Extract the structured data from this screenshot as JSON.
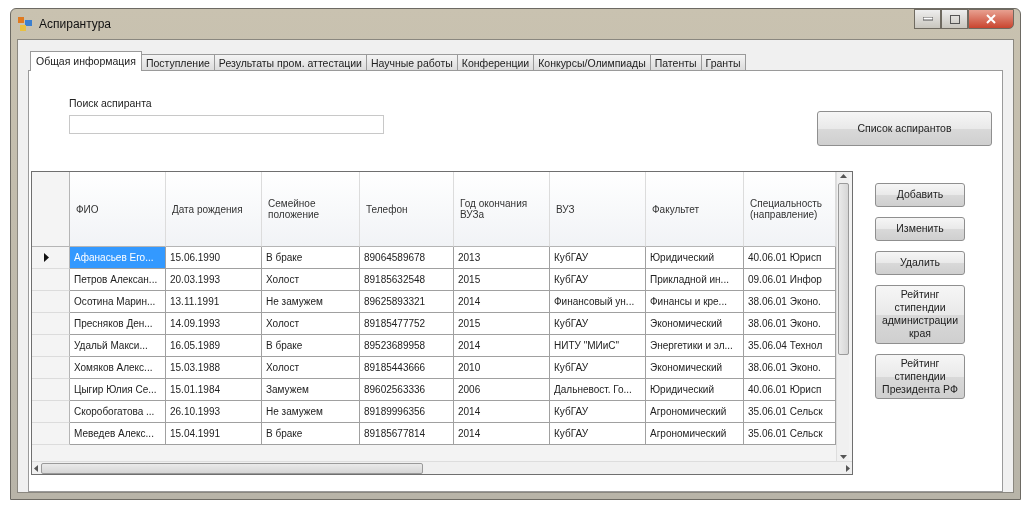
{
  "window": {
    "title": "Аспирантура"
  },
  "tabs": [
    {
      "label": "Общая информация",
      "selected": true
    },
    {
      "label": "Поступление",
      "selected": false
    },
    {
      "label": "Результаты пром. аттестации",
      "selected": false
    },
    {
      "label": "Научные работы",
      "selected": false
    },
    {
      "label": "Конференции",
      "selected": false
    },
    {
      "label": "Конкурсы/Олимпиады",
      "selected": false
    },
    {
      "label": "Патенты",
      "selected": false
    },
    {
      "label": "Гранты",
      "selected": false
    }
  ],
  "search": {
    "label": "Поиск аспиранта"
  },
  "list_button": "Список аспирантов",
  "table": {
    "columns": [
      "ФИО",
      "Дата рождения",
      "Семейное положение",
      "Телефон",
      "Год окончания ВУЗа",
      "ВУЗ",
      "Факультет",
      "Специальность (направление)"
    ],
    "rows": [
      {
        "selected": true,
        "cells": [
          "Афанасьев Его...",
          "15.06.1990",
          "В браке",
          "89064589678",
          "2013",
          "КубГАУ",
          "Юридический",
          "40.06.01 Юрисп"
        ]
      },
      {
        "selected": false,
        "cells": [
          "Петров Алексан...",
          "20.03.1993",
          "Холост",
          "89185632548",
          "2015",
          "КубГАУ",
          "Прикладной ин...",
          "09.06.01 Инфор"
        ]
      },
      {
        "selected": false,
        "cells": [
          "Осотина Марин...",
          "13.11.1991",
          "Не замужем",
          "89625893321",
          "2014",
          "Финансовый ун...",
          "Финансы и кре...",
          "38.06.01 Эконо."
        ]
      },
      {
        "selected": false,
        "cells": [
          "Пресняков Ден...",
          "14.09.1993",
          "Холост",
          "89185477752",
          "2015",
          "КубГАУ",
          "Экономический",
          "38.06.01 Эконо."
        ]
      },
      {
        "selected": false,
        "cells": [
          "Удальй Макси...",
          "16.05.1989",
          "В браке",
          "89523689958",
          "2014",
          "НИТУ \"МИиС\"",
          "Энергетики и эл...",
          "35.06.04 Технол"
        ]
      },
      {
        "selected": false,
        "cells": [
          "Хомяков Алекс...",
          "15.03.1988",
          "Холост",
          "89185443666",
          "2010",
          "КубГАУ",
          "Экономический",
          "38.06.01 Эконо."
        ]
      },
      {
        "selected": false,
        "cells": [
          "Цыгир Юлия Се...",
          "15.01.1984",
          "Замужем",
          "89602563336",
          "2006",
          "Дальневост. Го...",
          "Юридический",
          "40.06.01 Юрисп"
        ]
      },
      {
        "selected": false,
        "cells": [
          "Скоробогатова ...",
          "26.10.1993",
          "Не замужем",
          "89189996356",
          "2014",
          "КубГАУ",
          "Агрономический",
          "35.06.01 Сельск"
        ]
      },
      {
        "selected": false,
        "cells": [
          "Меведев Алекс...",
          "15.04.1991",
          "В браке",
          "89185677814",
          "2014",
          "КубГАУ",
          "Агрономический",
          "35.06.01 Сельск"
        ]
      }
    ]
  },
  "side_buttons": [
    "Добавить",
    "Изменить",
    "Удалить",
    "Рейтинг стипендии администрации края",
    "Рейтинг стипендии Президента РФ"
  ]
}
